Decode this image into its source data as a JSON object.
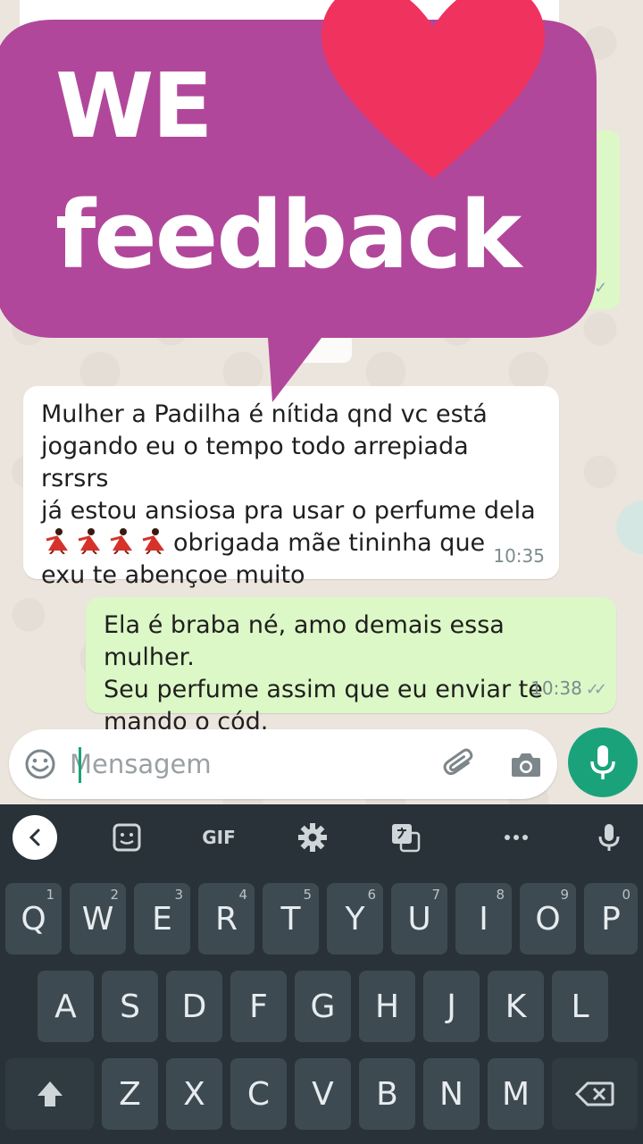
{
  "chat": {
    "incoming": {
      "line1": "Mulher a Padilha é nítida qnd vc está",
      "line2": "jogando eu o tempo todo arrepiada rsrsrs",
      "line3": "já estou ansiosa pra usar o perfume dela",
      "line4": "obrigada mãe tininha que",
      "line5": "exu te abençoe muito",
      "emoji": "dancer-emoji",
      "emoji_count": 4,
      "time": "10:35"
    },
    "outgoing": {
      "line1": "Ela é braba né, amo demais essa mulher.",
      "line2": "Seu perfume assim que eu enviar te",
      "line3": "mando o cód.",
      "time": "10:38",
      "status": "read-ticks-icon"
    }
  },
  "overlay": {
    "line1": "WE",
    "line2": "feedback",
    "bubble_color": "#b1479b",
    "heart_color": "#f0325f"
  },
  "input": {
    "placeholder": "Mensagem"
  },
  "keyboard": {
    "toolbar": {
      "gif_label": "GIF"
    },
    "rows": [
      [
        {
          "k": "Q",
          "h": "1"
        },
        {
          "k": "W",
          "h": "2"
        },
        {
          "k": "E",
          "h": "3"
        },
        {
          "k": "R",
          "h": "4"
        },
        {
          "k": "T",
          "h": "5"
        },
        {
          "k": "Y",
          "h": "6"
        },
        {
          "k": "U",
          "h": "7"
        },
        {
          "k": "I",
          "h": "8"
        },
        {
          "k": "O",
          "h": "9"
        },
        {
          "k": "P",
          "h": "0"
        }
      ],
      [
        {
          "k": "A"
        },
        {
          "k": "S"
        },
        {
          "k": "D"
        },
        {
          "k": "F"
        },
        {
          "k": "G"
        },
        {
          "k": "H"
        },
        {
          "k": "J"
        },
        {
          "k": "K"
        },
        {
          "k": "L"
        }
      ],
      [
        {
          "k": "Z"
        },
        {
          "k": "X"
        },
        {
          "k": "C"
        },
        {
          "k": "V"
        },
        {
          "k": "B"
        },
        {
          "k": "N"
        },
        {
          "k": "M"
        }
      ]
    ]
  },
  "colors": {
    "accent": "#1aa37a",
    "incoming_bubble": "#ffffff",
    "outgoing_bubble": "#dcf8c6",
    "keyboard_bg": "#283238",
    "key_bg": "#3e4a51"
  }
}
